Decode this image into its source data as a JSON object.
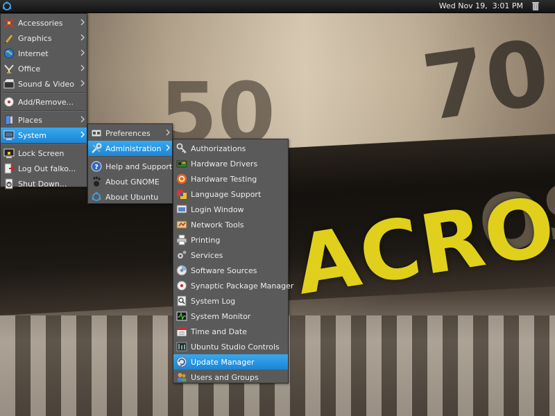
{
  "panel": {
    "clock": "Wed Nov 19,  3:01 PM",
    "icons": {
      "apps": "ubuntu-logo-icon",
      "trash": "trash-icon"
    }
  },
  "wallpaper": {
    "numbers": [
      "70",
      "50"
    ],
    "brand_text": "ACRO",
    "faded_text": "OS"
  },
  "main_menu": {
    "items": [
      {
        "label": "Accessories",
        "icon": "accessories-icon"
      },
      {
        "label": "Graphics",
        "icon": "graphics-icon"
      },
      {
        "label": "Internet",
        "icon": "internet-icon"
      },
      {
        "label": "Office",
        "icon": "office-icon"
      },
      {
        "label": "Sound & Video",
        "icon": "sound-video-icon"
      },
      {
        "label": "Add/Remove...",
        "icon": "add-remove-icon"
      },
      {
        "label": "Places",
        "icon": "places-icon"
      },
      {
        "label": "System",
        "icon": "system-icon"
      },
      {
        "label": "Lock Screen",
        "icon": "lock-screen-icon"
      },
      {
        "label": "Log Out falko...",
        "icon": "log-out-icon"
      },
      {
        "label": "Shut Down...",
        "icon": "shut-down-icon"
      }
    ]
  },
  "system_menu": {
    "items": [
      {
        "label": "Preferences",
        "icon": "preferences-icon"
      },
      {
        "label": "Administration",
        "icon": "administration-icon"
      },
      {
        "label": "Help and Support",
        "icon": "help-icon"
      },
      {
        "label": "About GNOME",
        "icon": "gnome-icon"
      },
      {
        "label": "About Ubuntu",
        "icon": "ubuntu-icon"
      }
    ]
  },
  "admin_menu": {
    "items": [
      {
        "label": "Authorizations",
        "icon": "authorizations-icon"
      },
      {
        "label": "Hardware Drivers",
        "icon": "hardware-drivers-icon"
      },
      {
        "label": "Hardware Testing",
        "icon": "hardware-testing-icon"
      },
      {
        "label": "Language Support",
        "icon": "language-support-icon"
      },
      {
        "label": "Login Window",
        "icon": "login-window-icon"
      },
      {
        "label": "Network Tools",
        "icon": "network-tools-icon"
      },
      {
        "label": "Printing",
        "icon": "printer-icon"
      },
      {
        "label": "Services",
        "icon": "services-icon"
      },
      {
        "label": "Software Sources",
        "icon": "software-sources-icon"
      },
      {
        "label": "Synaptic Package Manager",
        "icon": "synaptic-icon"
      },
      {
        "label": "System Log",
        "icon": "system-log-icon"
      },
      {
        "label": "System Monitor",
        "icon": "system-monitor-icon"
      },
      {
        "label": "Time and Date",
        "icon": "time-date-icon"
      },
      {
        "label": "Ubuntu Studio Controls",
        "icon": "studio-controls-icon"
      },
      {
        "label": "Update Manager",
        "icon": "update-manager-icon"
      },
      {
        "label": "Users and Groups",
        "icon": "users-groups-icon"
      }
    ]
  },
  "colors": {
    "highlight": "#1b86d6",
    "menu_bg": "#5a5a5a",
    "panel_bg": "#1c1c1c"
  }
}
